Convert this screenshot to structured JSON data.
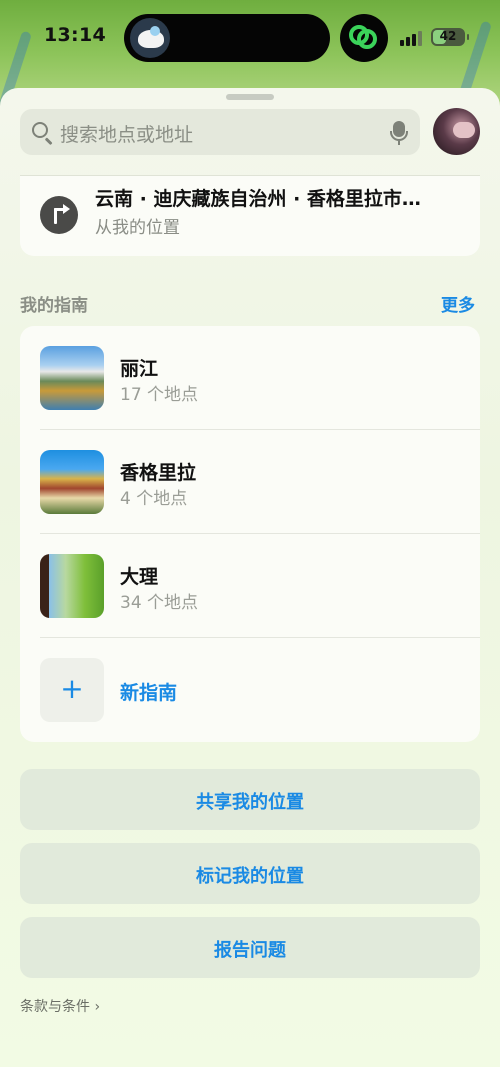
{
  "status_bar": {
    "time": "13:14",
    "battery_text": "42",
    "battery_level": 0.42
  },
  "search": {
    "placeholder": "搜索地点或地址"
  },
  "directions": {
    "title": "云南 · 迪庆藏族自治州 · 香格里拉市…",
    "subtitle": "从我的位置"
  },
  "guides_section": {
    "title": "我的指南",
    "more_label": "更多",
    "items": [
      {
        "name": "丽江",
        "count": "17 个地点"
      },
      {
        "name": "香格里拉",
        "count": "4 个地点"
      },
      {
        "name": "大理",
        "count": "34 个地点"
      }
    ],
    "new_guide_label": "新指南"
  },
  "actions": {
    "share_location": "共享我的位置",
    "mark_location": "标记我的位置",
    "report_issue": "报告问题"
  },
  "footer": {
    "terms": "条款与条件 ›"
  },
  "colors": {
    "accent": "#1a8ae4",
    "island_app": "#3bd35a"
  }
}
